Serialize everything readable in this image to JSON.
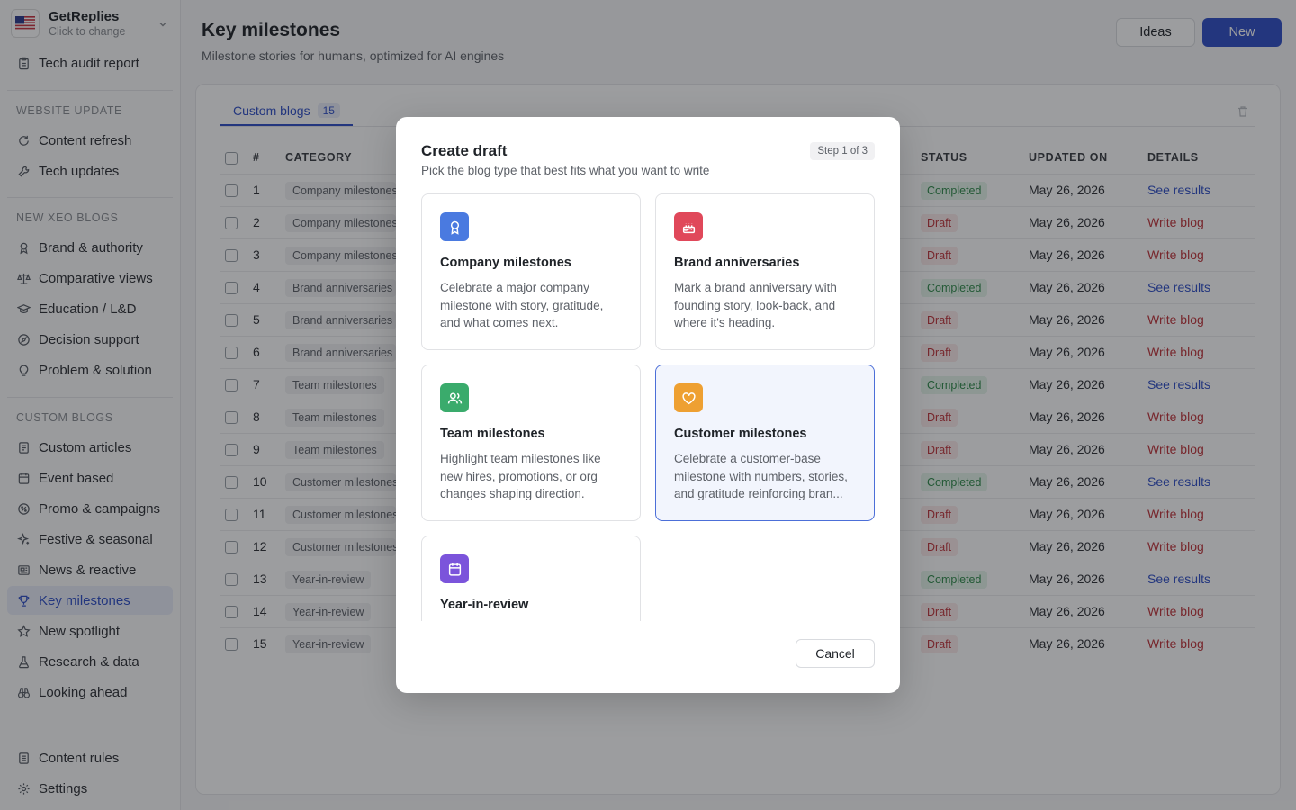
{
  "workspace": {
    "name": "GetReplies",
    "subtitle": "Click to change"
  },
  "sidebar": {
    "top_items": [
      {
        "label": "Tech audit report",
        "icon": "clipboard-icon"
      }
    ],
    "sections": [
      {
        "label": "WEBSITE UPDATE",
        "items": [
          {
            "label": "Content refresh",
            "icon": "refresh-icon"
          },
          {
            "label": "Tech updates",
            "icon": "wrench-icon"
          }
        ]
      },
      {
        "label": "NEW XEO BLOGS",
        "items": [
          {
            "label": "Brand & authority",
            "icon": "badge-icon"
          },
          {
            "label": "Comparative views",
            "icon": "scale-icon"
          },
          {
            "label": "Education / L&D",
            "icon": "graduation-cap-icon"
          },
          {
            "label": "Decision support",
            "icon": "compass-icon"
          },
          {
            "label": "Problem & solution",
            "icon": "lightbulb-icon"
          }
        ]
      },
      {
        "label": "CUSTOM BLOGS",
        "items": [
          {
            "label": "Custom articles",
            "icon": "document-icon"
          },
          {
            "label": "Event based",
            "icon": "calendar-icon"
          },
          {
            "label": "Promo & campaigns",
            "icon": "percent-badge-icon"
          },
          {
            "label": "Festive & seasonal",
            "icon": "sparkle-icon"
          },
          {
            "label": "News & reactive",
            "icon": "newspaper-icon"
          },
          {
            "label": "Key milestones",
            "icon": "trophy-icon"
          },
          {
            "label": "New spotlight",
            "icon": "star-icon"
          },
          {
            "label": "Research & data",
            "icon": "flask-icon"
          },
          {
            "label": "Looking ahead",
            "icon": "binoculars-icon"
          }
        ]
      }
    ],
    "bottom_items": [
      {
        "label": "Content rules",
        "icon": "rules-icon"
      },
      {
        "label": "Settings",
        "icon": "gear-icon"
      }
    ],
    "active": "Key milestones"
  },
  "header": {
    "title": "Key milestones",
    "subtitle": "Milestone stories for humans, optimized for AI engines",
    "ideas_label": "Ideas",
    "new_label": "New"
  },
  "tabs": [
    {
      "label": "Custom blogs",
      "count": "15"
    }
  ],
  "table": {
    "columns": [
      "#",
      "CATEGORY",
      "STATUS",
      "UPDATED ON",
      "DETAILS"
    ],
    "rows": [
      {
        "num": "1",
        "category": "Company milestones",
        "status": "Completed",
        "updated": "May 26, 2026",
        "detail": "See results"
      },
      {
        "num": "2",
        "category": "Company milestones",
        "status": "Draft",
        "updated": "May 26, 2026",
        "detail": "Write blog"
      },
      {
        "num": "3",
        "category": "Company milestones",
        "status": "Draft",
        "updated": "May 26, 2026",
        "detail": "Write blog"
      },
      {
        "num": "4",
        "category": "Brand anniversaries",
        "status": "Completed",
        "updated": "May 26, 2026",
        "detail": "See results"
      },
      {
        "num": "5",
        "category": "Brand anniversaries",
        "status": "Draft",
        "updated": "May 26, 2026",
        "detail": "Write blog"
      },
      {
        "num": "6",
        "category": "Brand anniversaries",
        "status": "Draft",
        "updated": "May 26, 2026",
        "detail": "Write blog"
      },
      {
        "num": "7",
        "category": "Team milestones",
        "status": "Completed",
        "updated": "May 26, 2026",
        "detail": "See results"
      },
      {
        "num": "8",
        "category": "Team milestones",
        "status": "Draft",
        "updated": "May 26, 2026",
        "detail": "Write blog"
      },
      {
        "num": "9",
        "category": "Team milestones",
        "status": "Draft",
        "updated": "May 26, 2026",
        "detail": "Write blog"
      },
      {
        "num": "10",
        "category": "Customer milestones",
        "status": "Completed",
        "updated": "May 26, 2026",
        "detail": "See results"
      },
      {
        "num": "11",
        "category": "Customer milestones",
        "status": "Draft",
        "updated": "May 26, 2026",
        "detail": "Write blog"
      },
      {
        "num": "12",
        "category": "Customer milestones",
        "status": "Draft",
        "updated": "May 26, 2026",
        "detail": "Write blog"
      },
      {
        "num": "13",
        "category": "Year-in-review",
        "status": "Completed",
        "updated": "May 26, 2026",
        "detail": "See results"
      },
      {
        "num": "14",
        "category": "Year-in-review",
        "status": "Draft",
        "updated": "May 26, 2026",
        "detail": "Write blog"
      },
      {
        "num": "15",
        "category": "Year-in-review",
        "status": "Draft",
        "updated": "May 26, 2026",
        "detail": "Write blog"
      }
    ]
  },
  "modal": {
    "title": "Create draft",
    "subtitle": "Pick the blog type that best fits what you want to write",
    "step": "Step 1 of 3",
    "options": [
      {
        "title": "Company milestones",
        "desc": "Celebrate a major company milestone with story, gratitude, and what comes next.",
        "icon": "award-icon",
        "color": "#4a7ae0"
      },
      {
        "title": "Brand anniversaries",
        "desc": "Mark a brand anniversary with founding story, look-back, and where it's heading.",
        "icon": "cake-icon",
        "color": "#e0485a"
      },
      {
        "title": "Team milestones",
        "desc": "Highlight team milestones like new hires, promotions, or org changes shaping direction.",
        "icon": "users-icon",
        "color": "#3aab6c"
      },
      {
        "title": "Customer milestones",
        "desc": "Celebrate a customer-base milestone with numbers, stories, and gratitude reinforcing bran...",
        "icon": "heart-icon",
        "color": "#eea032"
      },
      {
        "title": "Year-in-review",
        "desc": "",
        "icon": "calendar-icon",
        "color": "#7b54db"
      }
    ],
    "selected": "Customer milestones",
    "cancel_label": "Cancel"
  },
  "colors": {
    "accent": "#2f4fc7",
    "completed": "#2f8a4a",
    "draft": "#c0353b"
  }
}
